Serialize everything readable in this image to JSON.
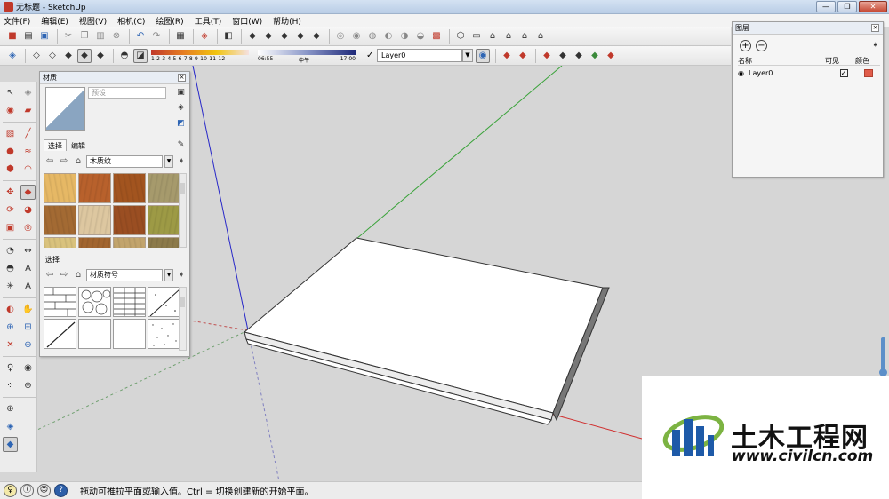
{
  "window": {
    "title": "无标题 - SketchUp",
    "controls": [
      "—",
      "❐",
      "✕"
    ]
  },
  "menu": [
    "文件(F)",
    "编辑(E)",
    "视图(V)",
    "相机(C)",
    "绘图(R)",
    "工具(T)",
    "窗口(W)",
    "帮助(H)"
  ],
  "shadow_bar": {
    "scale": "1 2 3 4 5 6 7 8 9 10 11 12"
  },
  "time_bar": {
    "start": "06:55",
    "mid": "中午",
    "end": "17:00"
  },
  "layer_select": {
    "current": "Layer0",
    "check": "✓"
  },
  "materials": {
    "title": "材质",
    "name_placeholder": "预设",
    "tabs": [
      "选择",
      "编辑"
    ],
    "collection": "木质纹",
    "lower_section_label": "选择",
    "lower_collection": "材质符号",
    "wood_colors": [
      "#e6b865",
      "#b8612c",
      "#a2541f",
      "#a69a6c",
      "#a36a33",
      "#ddc7a0",
      "#9a4e22",
      "#9d9a45",
      "#d9c27d",
      "#a2652f",
      "#c2a46c",
      "#8c7a4a"
    ]
  },
  "layers": {
    "title": "图层",
    "headers": {
      "name": "名称",
      "visible": "可见",
      "color": "颜色"
    },
    "rows": [
      {
        "name": "Layer0",
        "visible": "✓",
        "color": "#e05c4a"
      }
    ]
  },
  "watermark": {
    "brand_cn": "土木工程网",
    "url": "www.civilcn.com"
  },
  "status": {
    "hint": "拖动可推拉平面或输入值。Ctrl = 切换创建新的开始平面。"
  }
}
